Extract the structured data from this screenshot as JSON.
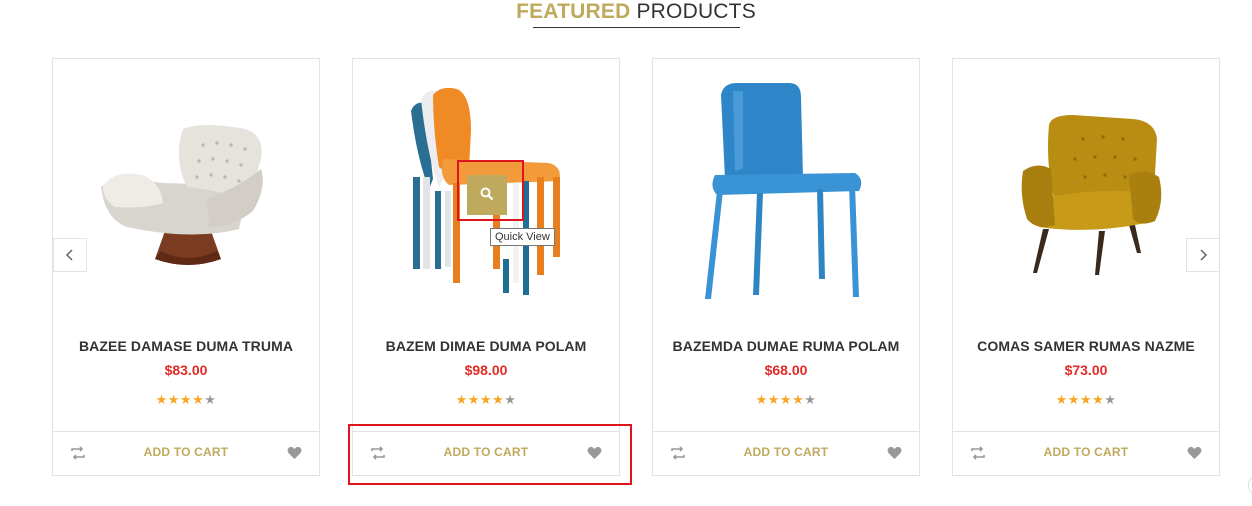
{
  "section": {
    "title_accent": "FEATURED",
    "title_rest": " PRODUCTS"
  },
  "carousel": {
    "prev_icon": "chevron-left-icon",
    "next_icon": "chevron-right-icon"
  },
  "quick_view": {
    "icon": "search-icon",
    "tooltip": "Quick View"
  },
  "products": [
    {
      "name": "BAZEE DAMASE DUMA TRUMA",
      "price": "$83.00",
      "rating": 4.5,
      "add_to_cart": "ADD TO CART",
      "image": "tufted-swivel-armchair"
    },
    {
      "name": "BAZEM DIMAE DUMA POLAM",
      "price": "$98.00",
      "rating": 4.5,
      "add_to_cart": "ADD TO CART",
      "image": "stacked-plastic-chairs"
    },
    {
      "name": "BAZEMDA DUMAE RUMA POLAM",
      "price": "$68.00",
      "rating": 4,
      "add_to_cart": "ADD TO CART",
      "image": "blue-plastic-chair"
    },
    {
      "name": "COMAS SAMER RUMAS NAZME",
      "price": "$73.00",
      "rating": 4,
      "add_to_cart": "ADD TO CART",
      "image": "mustard-velvet-armchair"
    }
  ],
  "colors": {
    "accent": "#bfa95c",
    "price": "#e02b27",
    "star": "#f5a623",
    "star_empty": "#999999"
  }
}
